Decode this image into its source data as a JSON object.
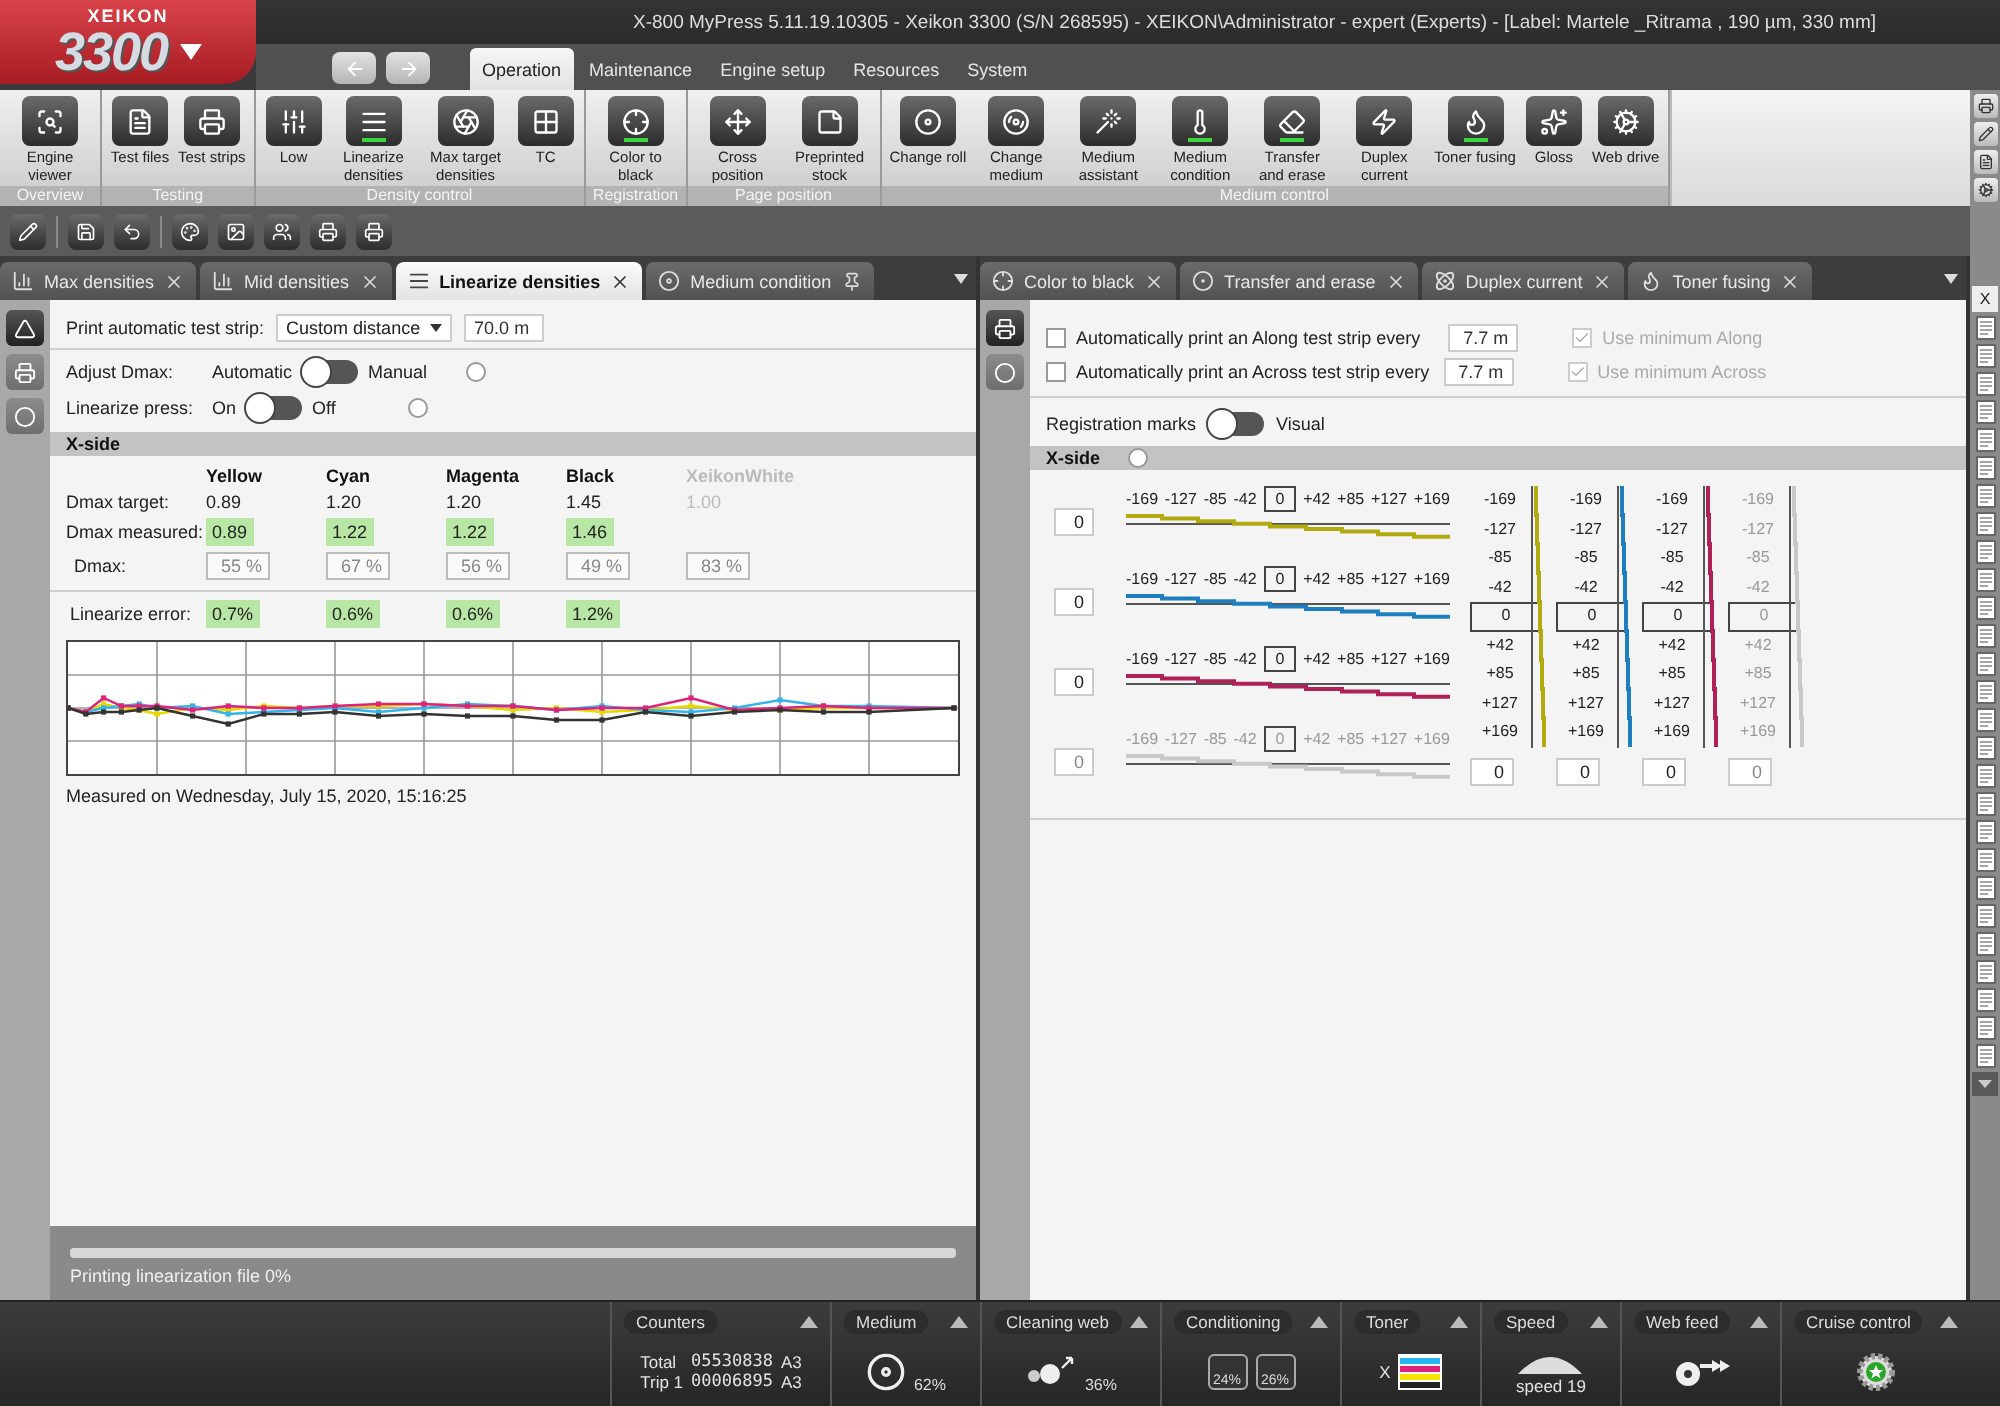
{
  "window": {
    "title": "X-800 MyPress 5.11.19.10305 - Xeikon 3300 (S/N 268595) - XEIKON\\Administrator - expert (Experts) - [Label: Martele _Ritrama , 190 µm, 330 mm]"
  },
  "logo": {
    "brand": "XEIKON",
    "model": "3300"
  },
  "nav_tabs": [
    {
      "label": "Operation",
      "selected": true
    },
    {
      "label": "Maintenance",
      "selected": false
    },
    {
      "label": "Engine setup",
      "selected": false
    },
    {
      "label": "Resources",
      "selected": false
    },
    {
      "label": "System",
      "selected": false
    }
  ],
  "ribbon_groups": [
    {
      "label": "Overview",
      "buttons": [
        {
          "label": "Engine viewer",
          "open": false
        }
      ]
    },
    {
      "label": "Testing",
      "buttons": [
        {
          "label": "Test files",
          "open": false
        },
        {
          "label": "Test strips",
          "open": false
        }
      ]
    },
    {
      "label": "Density control",
      "buttons": [
        {
          "label": "Low",
          "open": false
        },
        {
          "label": "Linearize densities",
          "open": true
        },
        {
          "label": "Max target densities",
          "open": false
        },
        {
          "label": "TC",
          "open": false
        }
      ]
    },
    {
      "label": "Registration",
      "buttons": [
        {
          "label": "Color to black",
          "open": true
        }
      ]
    },
    {
      "label": "Page position",
      "buttons": [
        {
          "label": "Cross position",
          "open": false
        },
        {
          "label": "Preprinted stock",
          "open": false
        }
      ]
    },
    {
      "label": "Medium control",
      "buttons": [
        {
          "label": "Change roll",
          "open": false
        },
        {
          "label": "Change medium",
          "open": false
        },
        {
          "label": "Medium assistant",
          "open": false
        },
        {
          "label": "Medium condition",
          "open": true
        },
        {
          "label": "Transfer and erase",
          "open": true
        },
        {
          "label": "Duplex current",
          "open": false
        },
        {
          "label": "Toner fusing",
          "open": true
        },
        {
          "label": "Gloss",
          "open": false
        },
        {
          "label": "Web drive",
          "open": false
        }
      ]
    }
  ],
  "left_pane": {
    "tabs": [
      {
        "label": "Max densities",
        "selected": false,
        "pinned": false
      },
      {
        "label": "Mid densities",
        "selected": false,
        "pinned": false
      },
      {
        "label": "Linearize densities",
        "selected": true,
        "pinned": false
      },
      {
        "label": "Medium condition",
        "selected": false,
        "pinned": true
      }
    ],
    "side_tools": [
      {
        "selected": true
      },
      {
        "selected": false
      },
      {
        "selected": false
      }
    ],
    "test_strip": {
      "label": "Print automatic test strip:",
      "mode": "Custom distance",
      "distance": "70.0 m"
    },
    "toggles": [
      {
        "label": "Adjust Dmax:",
        "left": "Automatic",
        "right": "Manual",
        "switched": false
      },
      {
        "label": "Linearize press:",
        "left": "On",
        "right": "Off",
        "switched": false
      }
    ],
    "section": "X-side",
    "row_labels": {
      "target": "Dmax target:",
      "measured": "Dmax measured:",
      "dmax": "Dmax:",
      "error": "Linearize error:"
    },
    "channels": [
      {
        "name": "Yellow",
        "enabled": true,
        "target": "0.89",
        "measured": "0.89",
        "dmax": "55 %",
        "error": "0.7%"
      },
      {
        "name": "Cyan",
        "enabled": true,
        "target": "1.20",
        "measured": "1.22",
        "dmax": "67 %",
        "error": "0.6%"
      },
      {
        "name": "Magenta",
        "enabled": true,
        "target": "1.20",
        "measured": "1.22",
        "dmax": "56 %",
        "error": "0.6%"
      },
      {
        "name": "Black",
        "enabled": true,
        "target": "1.45",
        "measured": "1.46",
        "dmax": "49 %",
        "error": "1.2%"
      },
      {
        "name": "XeikonWhite",
        "enabled": false,
        "target": "1.00",
        "dmax": "83 %"
      }
    ],
    "measured_on": "Measured on Wednesday, July 15, 2020, 15:16:25",
    "progress": {
      "label": "Printing linearization file 0%",
      "level": 0
    }
  },
  "right_pane": {
    "tabs": [
      {
        "label": "Color to black",
        "selected": false,
        "pinned": false
      },
      {
        "label": "Transfer and erase",
        "selected": false,
        "pinned": false
      },
      {
        "label": "Duplex current",
        "selected": false,
        "pinned": false
      },
      {
        "label": "Toner fusing",
        "selected": false,
        "pinned": false
      }
    ],
    "side_tools": [
      {
        "selected": true
      },
      {
        "selected": false
      }
    ],
    "auto_strips": [
      {
        "label": "Automatically print an Along test strip every",
        "checked": false,
        "distance": "7.7 m"
      },
      {
        "label": "Automatically print an Across test strip every",
        "checked": false,
        "distance": "7.7 m"
      }
    ],
    "minimums": [
      {
        "label": "Use minimum Along",
        "checked": true,
        "disabled": true
      },
      {
        "label": "Use minimum Across",
        "checked": true,
        "disabled": true
      }
    ],
    "registration_toggle": {
      "left": "Registration marks",
      "right": "Visual",
      "switched": false
    },
    "section": "X-side",
    "along": [
      {
        "color": "#b3aa10",
        "enabled": true,
        "value": "0",
        "scale": [
          "-169",
          "-127",
          "-85",
          "-42",
          "0",
          "+42",
          "+85",
          "+127",
          "+169"
        ]
      },
      {
        "color": "#1e7fc0",
        "enabled": true,
        "value": "0",
        "scale": [
          "-169",
          "-127",
          "-85",
          "-42",
          "0",
          "+42",
          "+85",
          "+127",
          "+169"
        ]
      },
      {
        "color": "#b0215a",
        "enabled": true,
        "value": "0",
        "scale": [
          "-169",
          "-127",
          "-85",
          "-42",
          "0",
          "+42",
          "+85",
          "+127",
          "+169"
        ]
      },
      {
        "color": "#c8c8c8",
        "enabled": false,
        "value": "0",
        "scale": [
          "-169",
          "-127",
          "-85",
          "-42",
          "0",
          "+42",
          "+85",
          "+127",
          "+169"
        ]
      }
    ],
    "across": [
      {
        "color": "#b3aa10",
        "enabled": true,
        "value": "0",
        "scale": [
          "-169",
          "-127",
          "-85",
          "-42",
          "0",
          "+42",
          "+85",
          "+127",
          "+169"
        ]
      },
      {
        "color": "#1e7fc0",
        "enabled": true,
        "value": "0",
        "scale": [
          "-169",
          "-127",
          "-85",
          "-42",
          "0",
          "+42",
          "+85",
          "+127",
          "+169"
        ]
      },
      {
        "color": "#b0215a",
        "enabled": true,
        "value": "0",
        "scale": [
          "-169",
          "-127",
          "-85",
          "-42",
          "0",
          "+42",
          "+85",
          "+127",
          "+169"
        ]
      },
      {
        "color": "#c8c8c8",
        "enabled": false,
        "value": "0",
        "scale": [
          "-169",
          "-127",
          "-85",
          "-42",
          "0",
          "+42",
          "+85",
          "+127",
          "+169"
        ]
      }
    ]
  },
  "side_list": {
    "label": "X"
  },
  "status_panels": [
    {
      "kind": "counters",
      "title": "Counters",
      "rows": [
        {
          "label": "Total",
          "value": "05530838",
          "format": "A3"
        },
        {
          "label": "Trip 1",
          "value": "00006895",
          "format": "A3"
        }
      ]
    },
    {
      "kind": "medium",
      "title": "Medium",
      "reading": "62%"
    },
    {
      "kind": "cleaning",
      "title": "Cleaning web",
      "reading": "36%"
    },
    {
      "kind": "conditioning",
      "title": "Conditioning",
      "readings": [
        "24%",
        "26%"
      ]
    },
    {
      "kind": "toner",
      "title": "Toner",
      "reading": "X"
    },
    {
      "kind": "speed",
      "title": "Speed",
      "reading": "speed 19"
    },
    {
      "kind": "webfeed",
      "title": "Web feed"
    },
    {
      "kind": "cruise",
      "title": "Cruise control"
    }
  ]
}
